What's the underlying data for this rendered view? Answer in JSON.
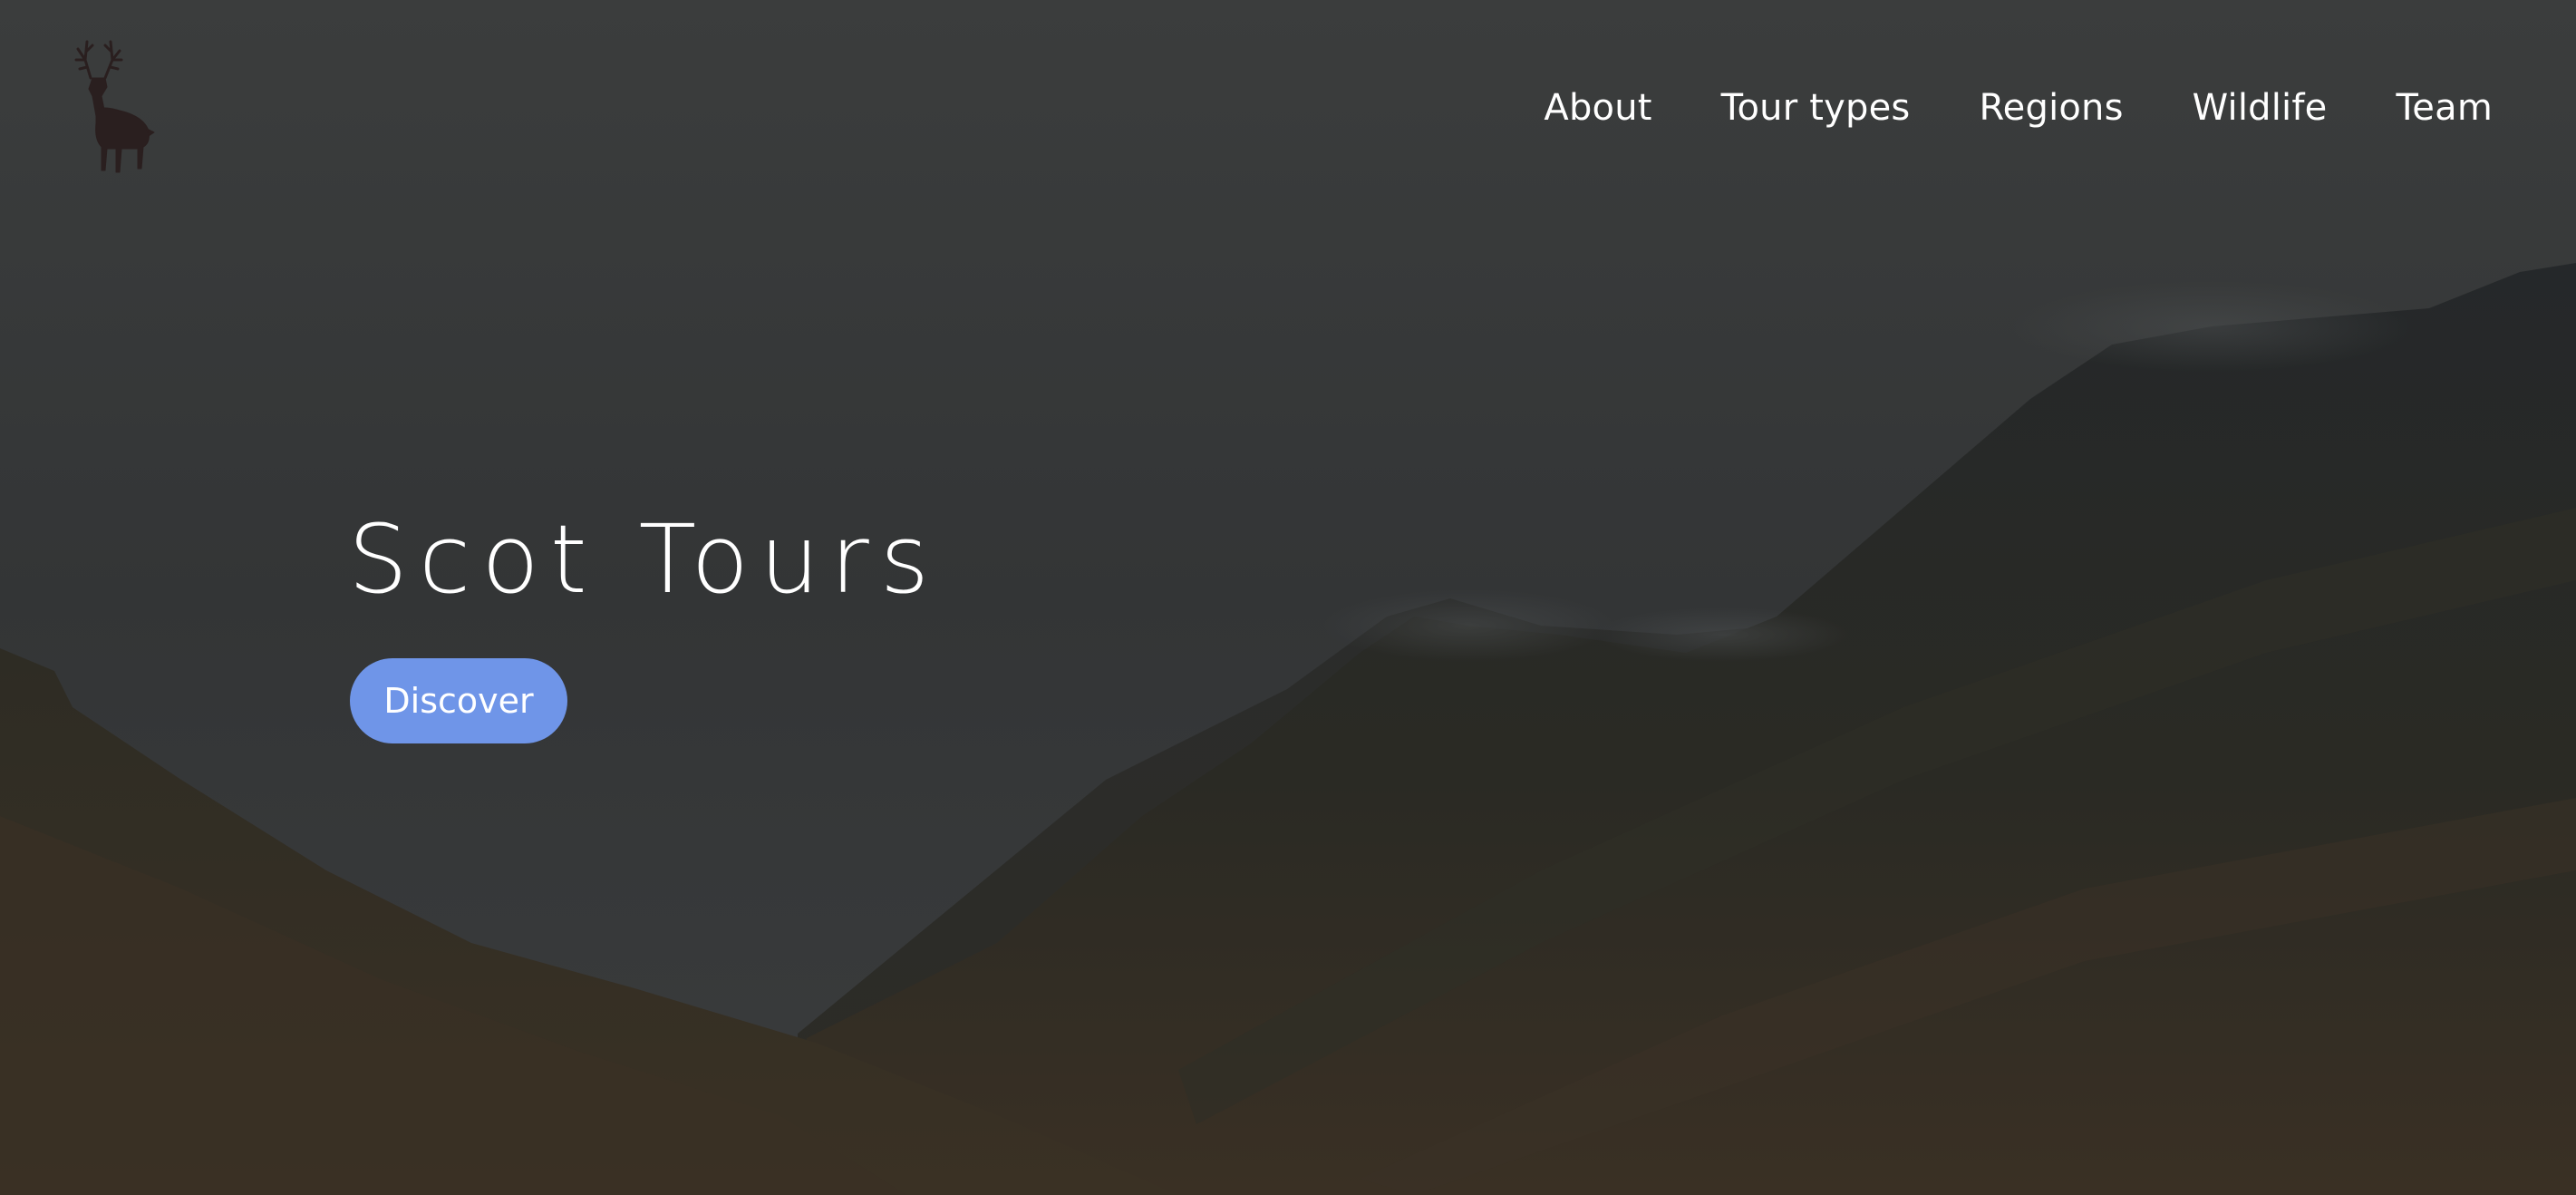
{
  "site": {
    "title": "Scot Tours",
    "logo_icon": "stag-icon"
  },
  "nav": {
    "items": [
      {
        "label": "About"
      },
      {
        "label": "Tour types"
      },
      {
        "label": "Regions"
      },
      {
        "label": "Wildlife"
      },
      {
        "label": "Team"
      }
    ]
  },
  "hero": {
    "title": "Scot Tours",
    "cta_label": "Discover",
    "background": "dark-misty-highland-glen"
  },
  "colors": {
    "accent": "#6f95e8",
    "text": "#ffffff",
    "sky": "#3a3c3c",
    "mountain": "#2a2a22"
  }
}
